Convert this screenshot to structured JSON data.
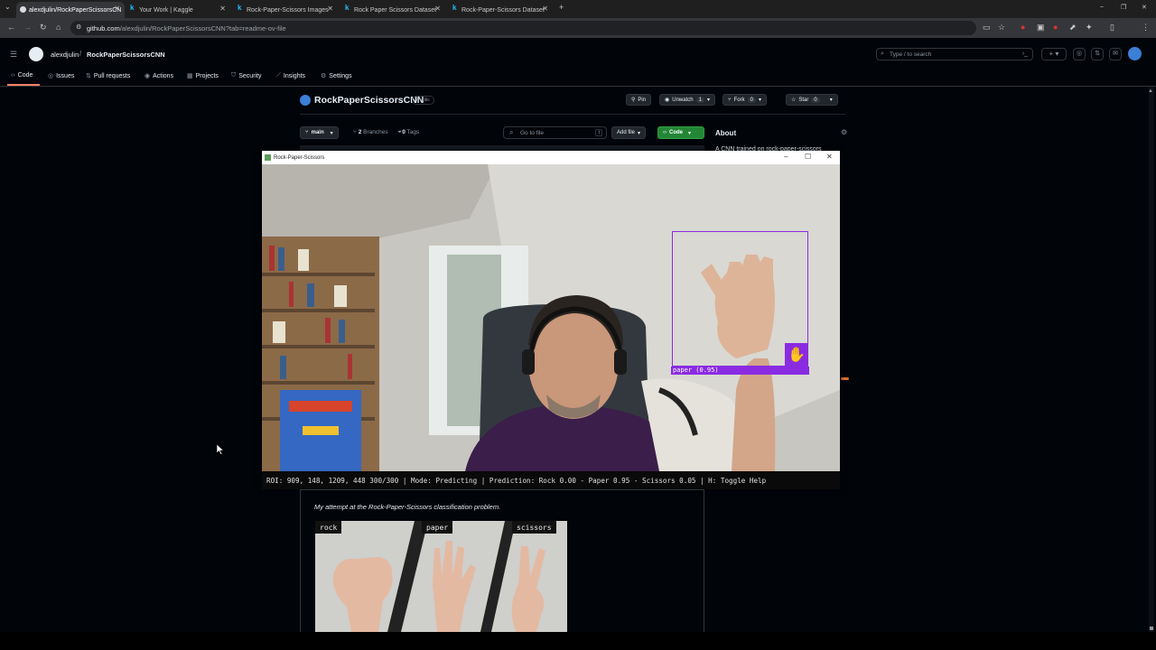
{
  "browser": {
    "tabs": [
      {
        "title": "alexdjulin/RockPaperScissorsCN",
        "active": true
      },
      {
        "title": "Your Work | Kaggle",
        "active": false
      },
      {
        "title": "Rock-Paper-Scissors Images",
        "active": false
      },
      {
        "title": "Rock Paper Scissors Dataset",
        "active": false
      },
      {
        "title": "Rock-Paper-Scissors Dataset",
        "active": false
      }
    ],
    "url_host": "github.com",
    "url_path": "/alexdjulin/RockPaperScissorsCNN?tab=readme-ov-file",
    "new_tab": "+"
  },
  "github": {
    "owner": "alexdjulin",
    "separator": "/",
    "repo": "RockPaperScissorsCNN",
    "search_placeholder": "Type / to search",
    "nav": [
      "Code",
      "Issues",
      "Pull requests",
      "Actions",
      "Projects",
      "Security",
      "Insights",
      "Settings"
    ],
    "repo_title": "RockPaperScissorsCNN",
    "visibility": "Public",
    "actions": {
      "pin": "Pin",
      "unwatch": "Unwatch",
      "unwatch_count": "1",
      "fork": "Fork",
      "fork_count": "0",
      "star": "Star",
      "star_count": "0"
    },
    "branch": "main",
    "branches_count": "2",
    "branches_label": "Branches",
    "tags_count": "0",
    "tags_label": "Tags",
    "goto_file": "Go to file",
    "goto_key": "t",
    "add_file": "Add file",
    "code_button": "Code",
    "about": "About",
    "about_partial": "A CNN trained on rock-paper-scissors"
  },
  "popup": {
    "title": "Rock-Paper-Scissors",
    "roi_label": "paper (0.95)",
    "status": "ROI: 909, 148, 1209, 448 300/300 | Mode: Predicting | Prediction: Rock 0.00 - Paper 0.95 - Scissors 0.05 | H: Toggle Help",
    "controls": {
      "minimize": "–",
      "maximize": "☐",
      "close": "✕"
    }
  },
  "readme": {
    "intro": "My attempt at the Rock-Paper-Scissors classification problem.",
    "image_labels": [
      "rock",
      "paper",
      "scissors"
    ]
  },
  "colors": {
    "accent_purple": "#8a2be2",
    "green_button": "#238636",
    "github_bg": "#010409"
  }
}
